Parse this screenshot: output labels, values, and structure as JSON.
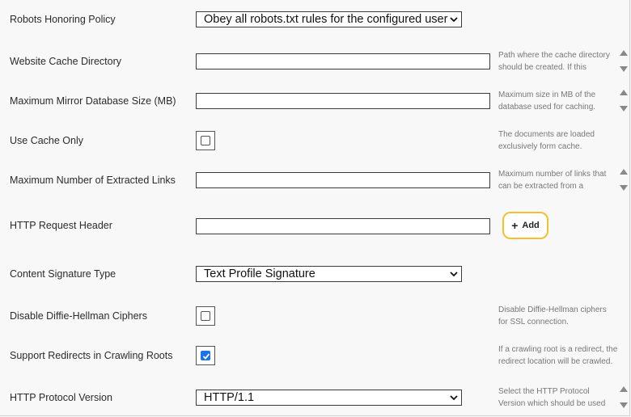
{
  "rows": {
    "robots": {
      "label": "Robots Honoring Policy",
      "value": "Obey all robots.txt rules for the configured user"
    },
    "cache_dir": {
      "label": "Website Cache Directory",
      "value": "",
      "help": "Path where the cache directory should be created. If this"
    },
    "mirror_db": {
      "label": "Maximum Mirror Database Size (MB)",
      "value": "",
      "help": "Maximum size in MB of the database used for caching."
    },
    "cache_only": {
      "label": "Use Cache Only",
      "checked": false,
      "help": "The documents are loaded exclusively form cache."
    },
    "max_links": {
      "label": "Maximum Number of Extracted Links",
      "value": "",
      "help": "Maximum number of links that can be extracted from a"
    },
    "http_header": {
      "label": "HTTP Request Header",
      "value": "",
      "add_label": "Add"
    },
    "content_sig": {
      "label": "Content Signature Type",
      "value": "Text Profile Signature"
    },
    "diffie": {
      "label": "Disable Diffie-Hellman Ciphers",
      "checked": false,
      "help": "Disable Diffie-Hellman ciphers for SSL connection."
    },
    "redirects": {
      "label": "Support Redirects in Crawling Roots",
      "checked": true,
      "help": "If a crawling root is a redirect, the redirect location will be crawled."
    },
    "protocol": {
      "label": "HTTP Protocol Version",
      "value": "HTTP/1.1",
      "help": "Select the HTTP Protocol Version which should be used"
    }
  },
  "icons": {
    "dropdown": "chevron-down-icon",
    "scroll_up": "triangle-up-icon",
    "scroll_down": "triangle-down-icon",
    "add": "plus-icon",
    "check": "check-icon"
  },
  "colors": {
    "accent": "#1a73e8",
    "add_border": "#f2c12e",
    "help_text": "#777777"
  }
}
